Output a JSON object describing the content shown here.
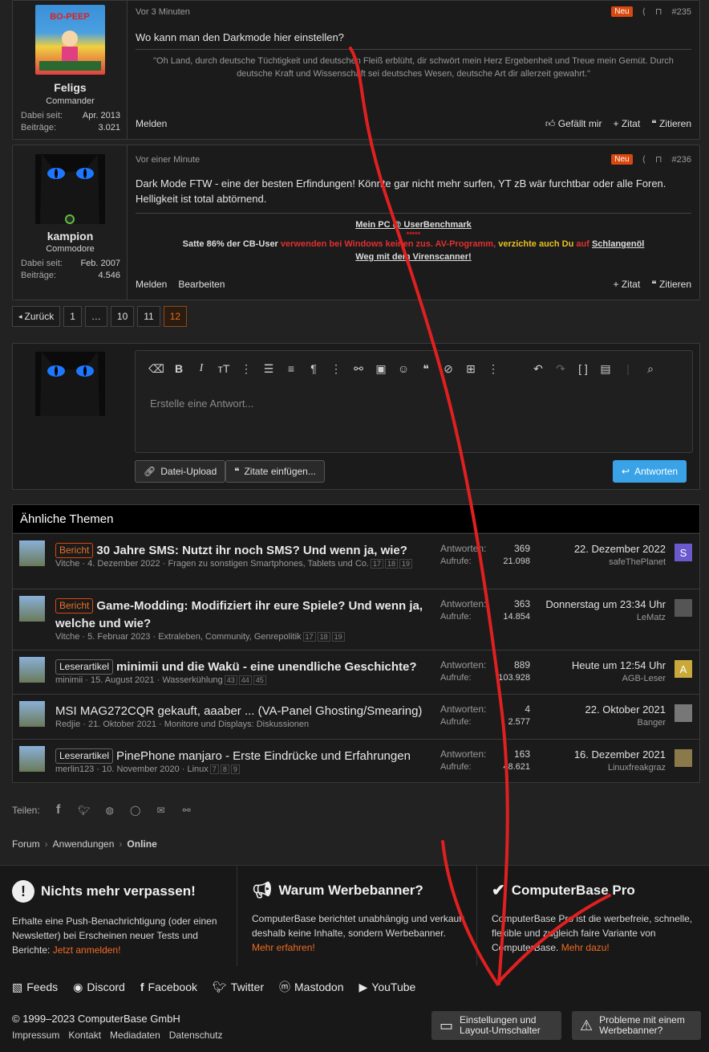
{
  "posts": [
    {
      "time": "Vor 3 Minuten",
      "badge": "Neu",
      "number": "#235",
      "text": "Wo kann man den Darkmode hier einstellen?",
      "sig": "\"Oh Land, durch deutsche Tüchtigkeit und deutschen Fleiß erblüht, dir schwört mein Herz Ergebenheit und Treue mein Gemüt. Durch deutsche Kraft und Wissenschaft sei deutsches Wesen, deutsche Art dir allerzeit gewahrt.\"",
      "username": "Feligs",
      "usertitle": "Commander",
      "joined_label": "Dabei seit:",
      "joined": "Apr. 2013",
      "posts_label": "Beiträge:",
      "posts": "3.021",
      "actions_left": [
        "Melden"
      ],
      "actions_right": [
        "Gefällt mir",
        "+ Zitat",
        "Zitieren"
      ]
    },
    {
      "time": "Vor einer Minute",
      "badge": "Neu",
      "number": "#236",
      "text": "Dark Mode FTW - eine der besten Erfindungen! Könnte gar nicht mehr surfen, YT zB wär furchtbar oder alle Foren. Helligkeit ist total abtörnend.",
      "sig_link": "Mein PC @ UserBenchmark",
      "sig_stars": "*****",
      "sig_line_a": "Satte 86% der CB-User ",
      "sig_line_b": "verwenden bei Windows keinen zus. AV-Programm, ",
      "sig_line_c": "verzichte auch Du ",
      "sig_line_d": "auf ",
      "sig_line_e": "Schlangenöl",
      "sig_line2": "Weg mit dem Virenscanner!",
      "username": "kampion",
      "usertitle": "Commodore",
      "joined_label": "Dabei seit:",
      "joined": "Feb. 2007",
      "posts_label": "Beiträge:",
      "posts": "4.546",
      "actions_left": [
        "Melden",
        "Bearbeiten"
      ],
      "actions_right": [
        "+ Zitat",
        "Zitieren"
      ]
    }
  ],
  "pager": {
    "back": "Zurück",
    "pages": [
      "1",
      "…",
      "10",
      "11",
      "12"
    ]
  },
  "editor": {
    "placeholder": "Erstelle eine Antwort...",
    "upload": "Datei-Upload",
    "quotes": "Zitate einfügen...",
    "submit": "Antworten"
  },
  "similar": {
    "title": "Ähnliche Themen",
    "answers_label": "Antworten:",
    "views_label": "Aufrufe:",
    "threads": [
      {
        "prefix": "Bericht",
        "title": "30 Jahre SMS: Nutzt ihr noch SMS? Und wenn ja, wie?",
        "author": "Vitche",
        "date": "4. Dezember 2022",
        "forum": "Fragen zu sonstigen Smartphones, Tablets und Co.",
        "pages": [
          "17",
          "18",
          "19"
        ],
        "answers": "369",
        "views": "21.098",
        "last_date": "22. Dezember 2022",
        "last_user": "safeThePlanet",
        "last_av": "S",
        "av_color": "#6a5acd"
      },
      {
        "prefix": "Bericht",
        "title": "Game-Modding: Modifiziert ihr eure Spiele? Und wenn ja, welche und wie?",
        "author": "Vitche",
        "date": "5. Februar 2023",
        "forum": "Extraleben, Community, Genrepolitik",
        "pages": [
          "17",
          "18",
          "19"
        ],
        "answers": "363",
        "views": "14.854",
        "last_date": "Donnerstag um 23:34 Uhr",
        "last_user": "LeMatz",
        "last_av": "",
        "av_color": "#555"
      },
      {
        "prefix": "Leserartikel",
        "title": "minimii und die Wakü - eine unendliche Geschichte?",
        "author": "minimii",
        "date": "15. August 2021",
        "forum": "Wasserkühlung",
        "pages": [
          "43",
          "44",
          "45"
        ],
        "answers": "889",
        "views": "103.928",
        "last_date": "Heute um 12:54 Uhr",
        "last_user": "AGB-Leser",
        "last_av": "A",
        "av_color": "#c9a93a"
      },
      {
        "prefix": "",
        "title": "MSI MAG272CQR gekauft, aaaber ... (VA-Panel Ghosting/Smearing)",
        "author": "Redjie",
        "date": "21. Oktober 2021",
        "forum": "Monitore und Displays: Diskussionen",
        "pages": [],
        "answers": "4",
        "views": "2.577",
        "last_date": "22. Oktober 2021",
        "last_user": "Banger",
        "last_av": "",
        "av_color": "#777"
      },
      {
        "prefix": "Leserartikel",
        "title": "PinePhone manjaro - Erste Eindrücke und Erfahrungen",
        "author": "merlin123",
        "date": "10. November 2020",
        "forum": "Linux",
        "pages": [
          "7",
          "8",
          "9"
        ],
        "answers": "163",
        "views": "48.621",
        "last_date": "16. Dezember 2021",
        "last_user": "Linuxfreakgraz",
        "last_av": "",
        "av_color": "#8a7a4a"
      }
    ]
  },
  "share": {
    "label": "Teilen:"
  },
  "breadcrumb": [
    "Forum",
    "Anwendungen",
    "Online"
  ],
  "footer": {
    "col1": {
      "title": "Nichts mehr verpassen!",
      "text": "Erhalte eine Push-Benachrichtigung (oder einen Newsletter) bei Erscheinen neuer Tests und Berichte: ",
      "link": "Jetzt anmelden!"
    },
    "col2": {
      "title": "Warum Werbebanner?",
      "text": "ComputerBase berichtet unabhängig und verkauft deshalb keine Inhalte, sondern Werbebanner. ",
      "link": "Mehr erfahren!"
    },
    "col3": {
      "title": "ComputerBase Pro",
      "text": "ComputerBase Pro ist die werbefreie, schnelle, flexible und zugleich faire Variante von ComputerBase. ",
      "link": "Mehr dazu!"
    },
    "social": [
      "Feeds",
      "Discord",
      "Facebook",
      "Twitter",
      "Mastodon",
      "YouTube"
    ],
    "copyright": "© 1999–2023 ComputerBase GmbH",
    "legal": [
      "Impressum",
      "Kontakt",
      "Mediadaten",
      "Datenschutz"
    ],
    "btn_settings_1": "Einstellungen und",
    "btn_settings_2": "Layout-Umschalter",
    "btn_problem_1": "Probleme mit einem",
    "btn_problem_2": "Werbebanner?"
  },
  "colors": {
    "accent": "#e86a1b",
    "button_blue": "#3aa3e8",
    "annotation": "#e02020"
  }
}
